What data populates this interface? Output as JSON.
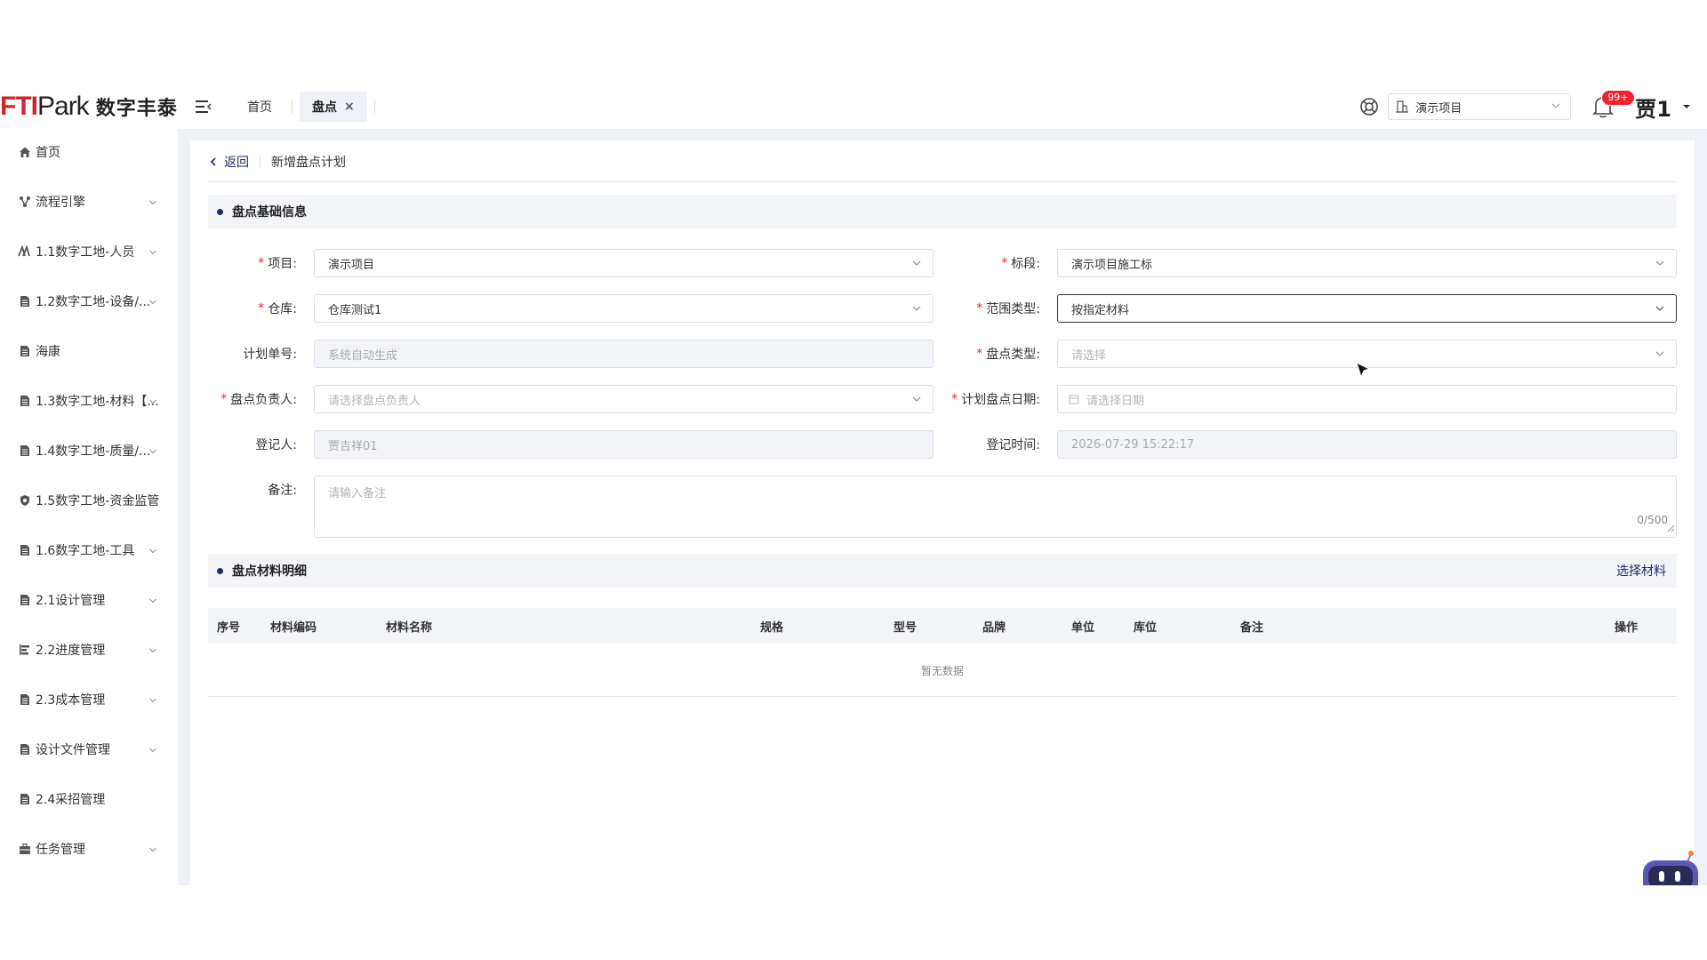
{
  "header": {
    "logo": {
      "fti": "FTI",
      "park": "Park",
      "cn": "数字丰泰"
    },
    "tabs": [
      {
        "label": "首页",
        "active": false
      },
      {
        "label": "盘点",
        "active": true,
        "close": "×"
      }
    ],
    "project": "演示项目",
    "badge": "99+",
    "user": "贾1"
  },
  "sidebar": {
    "items": [
      {
        "label": "首页",
        "icon": "home-icon",
        "expandable": false
      },
      {
        "label": "流程引擎",
        "icon": "workflow-icon",
        "expandable": true
      },
      {
        "label": "1.1数字工地-人员",
        "icon": "people-icon",
        "expandable": true
      },
      {
        "label": "1.2数字工地-设备/...",
        "icon": "document-icon",
        "expandable": true
      },
      {
        "label": "海康",
        "icon": "document-icon",
        "expandable": false
      },
      {
        "label": "1.3数字工地-材料【...",
        "icon": "document-icon",
        "expandable": true
      },
      {
        "label": "1.4数字工地-质量/...",
        "icon": "document-icon",
        "expandable": true
      },
      {
        "label": "1.5数字工地-资金监管",
        "icon": "shield-icon",
        "expandable": false
      },
      {
        "label": "1.6数字工地-工具",
        "icon": "document-icon",
        "expandable": true
      },
      {
        "label": "2.1设计管理",
        "icon": "document-icon",
        "expandable": true
      },
      {
        "label": "2.2进度管理",
        "icon": "progress-icon",
        "expandable": true
      },
      {
        "label": "2.3成本管理",
        "icon": "document-icon",
        "expandable": true
      },
      {
        "label": "设计文件管理",
        "icon": "document-icon",
        "expandable": true
      },
      {
        "label": "2.4采招管理",
        "icon": "document-icon",
        "expandable": false
      },
      {
        "label": "任务管理",
        "icon": "briefcase-icon",
        "expandable": true
      }
    ]
  },
  "breadcrumb": {
    "back": "返回",
    "title": "新增盘点计划"
  },
  "section_basic": {
    "title": "盘点基础信息"
  },
  "form": {
    "project": {
      "label": "项目:",
      "value": "演示项目"
    },
    "section": {
      "label": "标段:",
      "value": "演示项目施工标"
    },
    "warehouse": {
      "label": "仓库:",
      "value": "仓库测试1"
    },
    "scope_type": {
      "label": "范围类型:",
      "value": "按指定材料"
    },
    "plan_no": {
      "label": "计划单号:",
      "placeholder": "系统自动生成"
    },
    "count_type": {
      "label": "盘点类型:",
      "placeholder": "请选择"
    },
    "owner": {
      "label": "盘点负责人:",
      "placeholder": "请选择盘点负责人"
    },
    "plan_date": {
      "label": "计划盘点日期:",
      "placeholder": "请选择日期"
    },
    "recorder": {
      "label": "登记人:",
      "value": "贾吉祥01"
    },
    "record_time": {
      "label": "登记时间:",
      "value": "2026-07-29 15:22:17"
    },
    "remark": {
      "label": "备注:",
      "placeholder": "请输入备注",
      "counter": "0/500"
    }
  },
  "section_detail": {
    "title": "盘点材料明细",
    "action": "选择材料"
  },
  "table": {
    "columns": [
      "序号",
      "材料编码",
      "材料名称",
      "规格",
      "型号",
      "品牌",
      "单位",
      "库位",
      "备注",
      "操作"
    ],
    "empty": "暂无数据"
  },
  "colors": {
    "accent": "#1f2a6b",
    "logo_red": "#d0242b",
    "required": "#f5222d",
    "page_bg": "#eef1f6"
  }
}
